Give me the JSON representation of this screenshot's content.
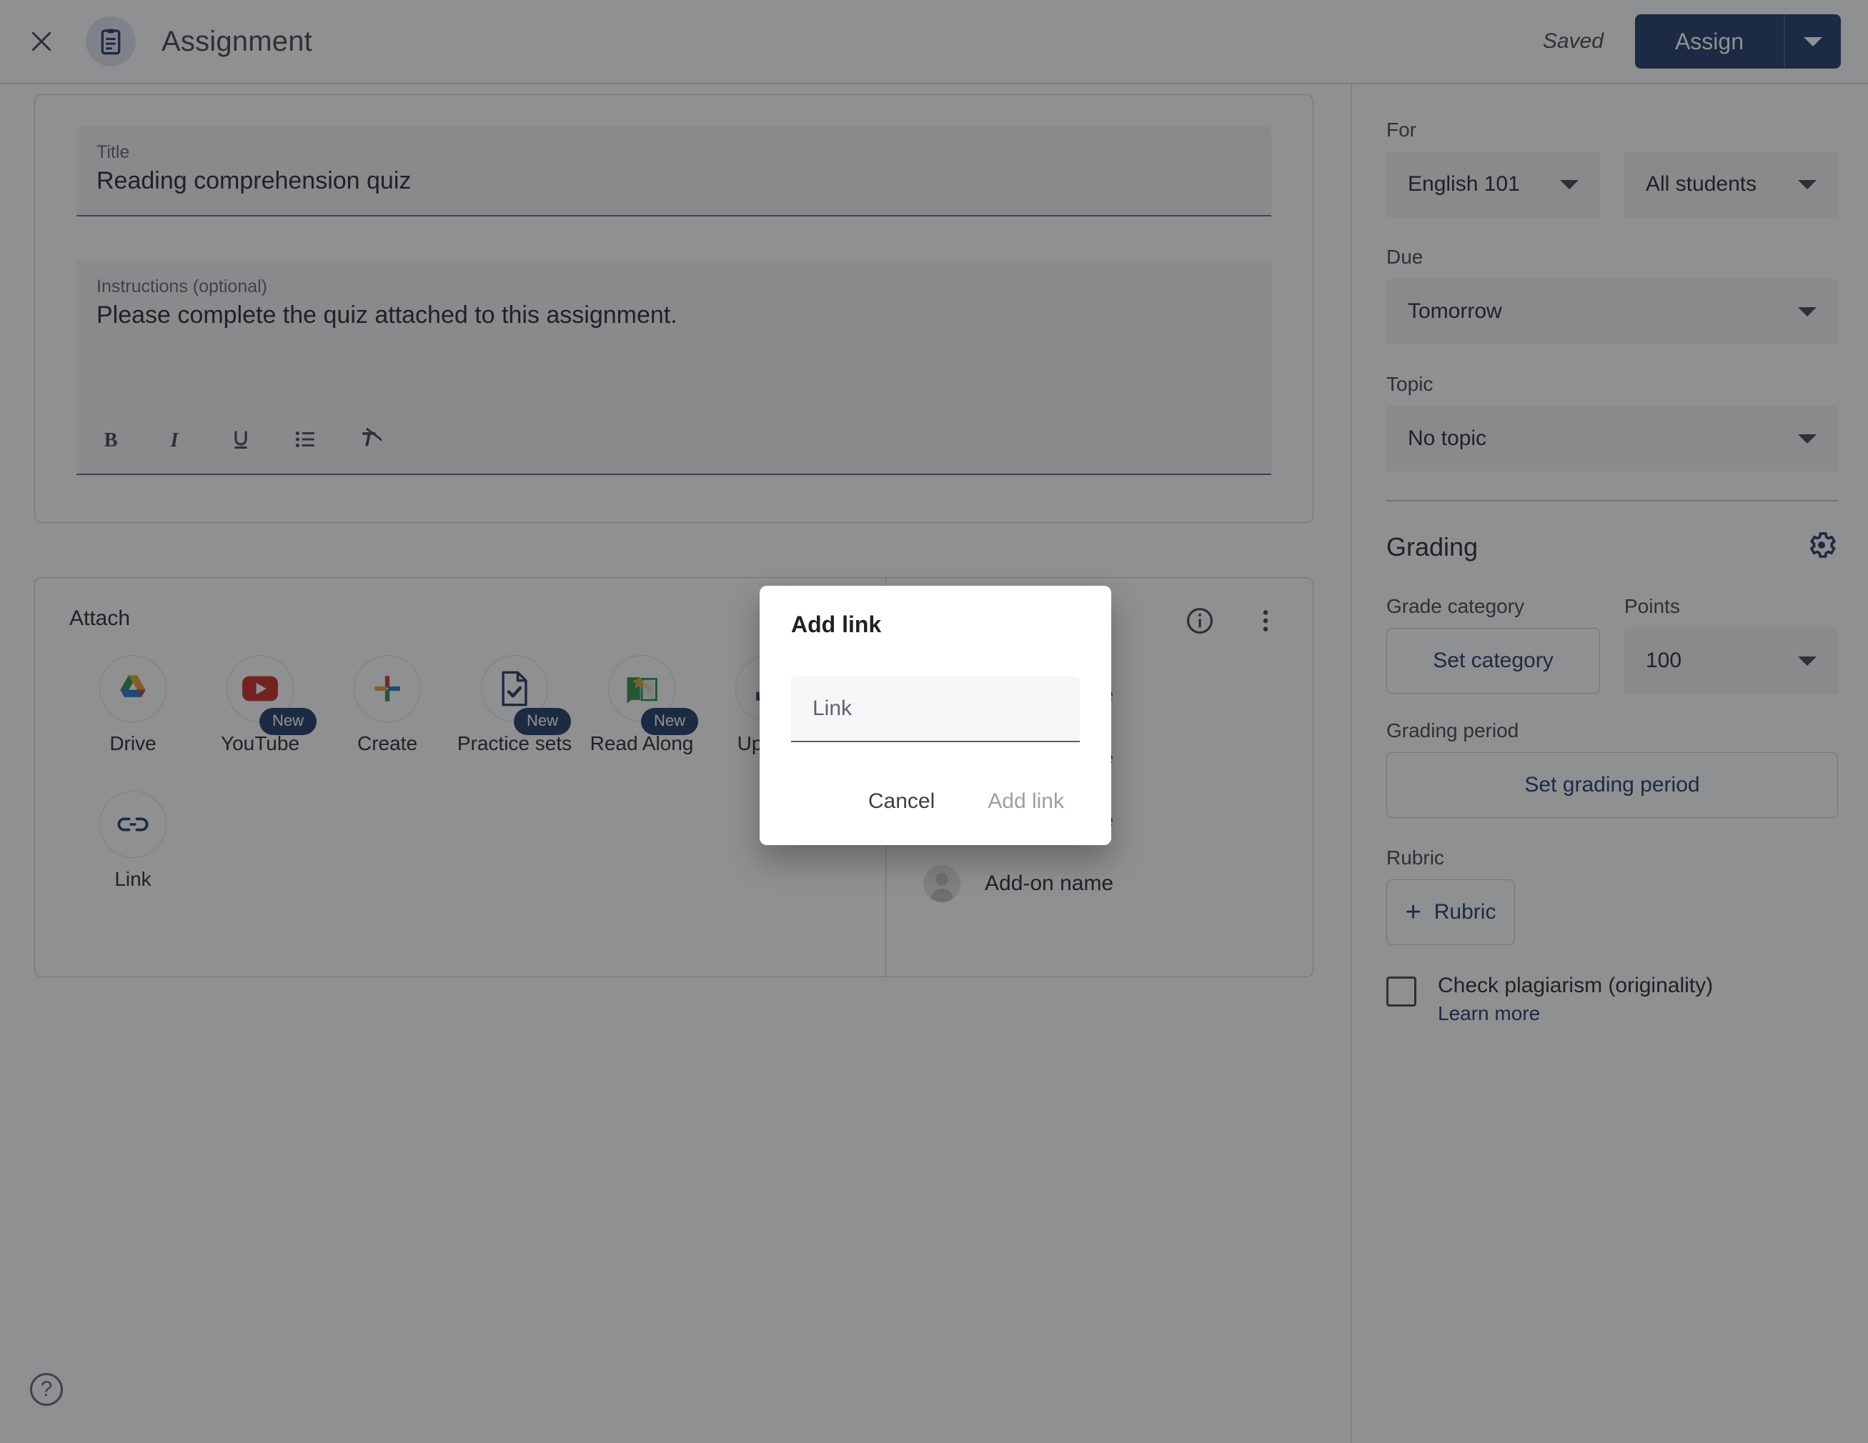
{
  "header": {
    "close_icon": "close-icon",
    "doc_icon": "clipboard-icon",
    "title": "Assignment",
    "saved_label": "Saved",
    "assign_label": "Assign",
    "assign_dropdown_icon": "chevron-down-icon"
  },
  "details": {
    "title_label": "Title",
    "title_value": "Reading comprehension quiz",
    "instructions_label": "Instructions (optional)",
    "instructions_value": "Please complete the quiz attached to this assignment.",
    "toolbar": [
      {
        "name": "bold-icon",
        "label": "B"
      },
      {
        "name": "italic-icon",
        "label": "I"
      },
      {
        "name": "underline-icon",
        "label": "U"
      },
      {
        "name": "bulleted-list-icon",
        "label": "list"
      },
      {
        "name": "clear-formatting-icon",
        "label": "clear"
      }
    ]
  },
  "attach": {
    "label": "Attach",
    "items": [
      {
        "label": "Drive",
        "icon": "google-drive-icon",
        "badge": null
      },
      {
        "label": "YouTube",
        "icon": "youtube-icon",
        "badge": "New"
      },
      {
        "label": "Create",
        "icon": "create-plus-icon",
        "badge": null
      },
      {
        "label": "Practice sets",
        "icon": "practice-sets-icon",
        "badge": "New"
      },
      {
        "label": "Read Along",
        "icon": "read-along-icon",
        "badge": "New"
      },
      {
        "label": "Upload",
        "icon": "upload-icon",
        "badge": null
      },
      {
        "label": "Link",
        "icon": "link-icon",
        "badge": null
      }
    ]
  },
  "addons": {
    "info_icon": "info-icon",
    "more_icon": "more-vertical-icon",
    "rows": [
      {
        "label": "Add-on name"
      },
      {
        "label": "Add-on name"
      },
      {
        "label": "Add-on name"
      },
      {
        "label": "Add-on name"
      }
    ]
  },
  "help": {
    "icon": "help-icon",
    "label": "?"
  },
  "sidebar": {
    "for_label": "For",
    "course_value": "English 101",
    "students_value": "All students",
    "due_label": "Due",
    "due_value": "Tomorrow",
    "topic_label": "Topic",
    "topic_value": "No topic",
    "grading_title": "Grading",
    "grading_settings_icon": "gear-icon",
    "grade_category_label": "Grade category",
    "grade_category_button": "Set category",
    "points_label": "Points",
    "points_value": "100",
    "grading_period_label": "Grading period",
    "grading_period_button": "Set grading period",
    "rubric_label": "Rubric",
    "rubric_button": "Rubric",
    "plagiarism_label": "Check plagiarism (originality)",
    "plagiarism_learn_more": "Learn more"
  },
  "dialog": {
    "title": "Add link",
    "field_placeholder": "Link",
    "field_value": "",
    "cancel_label": "Cancel",
    "submit_label": "Add link"
  },
  "colors": {
    "brand_navy": "#1a3263",
    "scrim": "rgba(32,33,36,0.5)",
    "field_fill": "#f1f3f4"
  }
}
